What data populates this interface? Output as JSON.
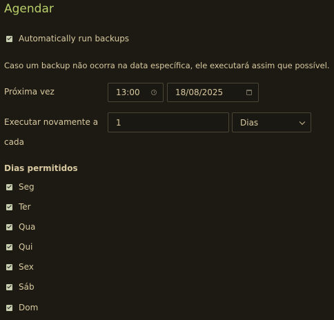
{
  "title": "Agendar",
  "auto_backup": {
    "label": "Automatically run backups",
    "checked": true
  },
  "info_text": "Caso um backup não ocorra na data específica, ele executará assim que possível.",
  "next_time": {
    "label": "Próxima vez",
    "time_value": "13:00",
    "date_value": "18/08/2025"
  },
  "repeat": {
    "label_line1": "Executar novamente a",
    "label_line2": "cada",
    "value": "1",
    "unit": "Dias"
  },
  "allowed_days": {
    "heading": "Dias permitidos",
    "days": [
      {
        "label": "Seg",
        "checked": true
      },
      {
        "label": "Ter",
        "checked": true
      },
      {
        "label": "Qua",
        "checked": true
      },
      {
        "label": "Qui",
        "checked": true
      },
      {
        "label": "Sex",
        "checked": true
      },
      {
        "label": "Sáb",
        "checked": true
      },
      {
        "label": "Dom",
        "checked": true
      }
    ]
  },
  "icons": {
    "time": "clock-icon",
    "date": "calendar-icon",
    "unit_select": "chevron-down-icon",
    "checkbox": "checkmark-icon"
  },
  "colors": {
    "background": "#1c1a13",
    "title": "#b9cf6a",
    "text": "#d8c9a0",
    "field_border": "#4a4535",
    "checkbox": "#c7cfb0"
  }
}
